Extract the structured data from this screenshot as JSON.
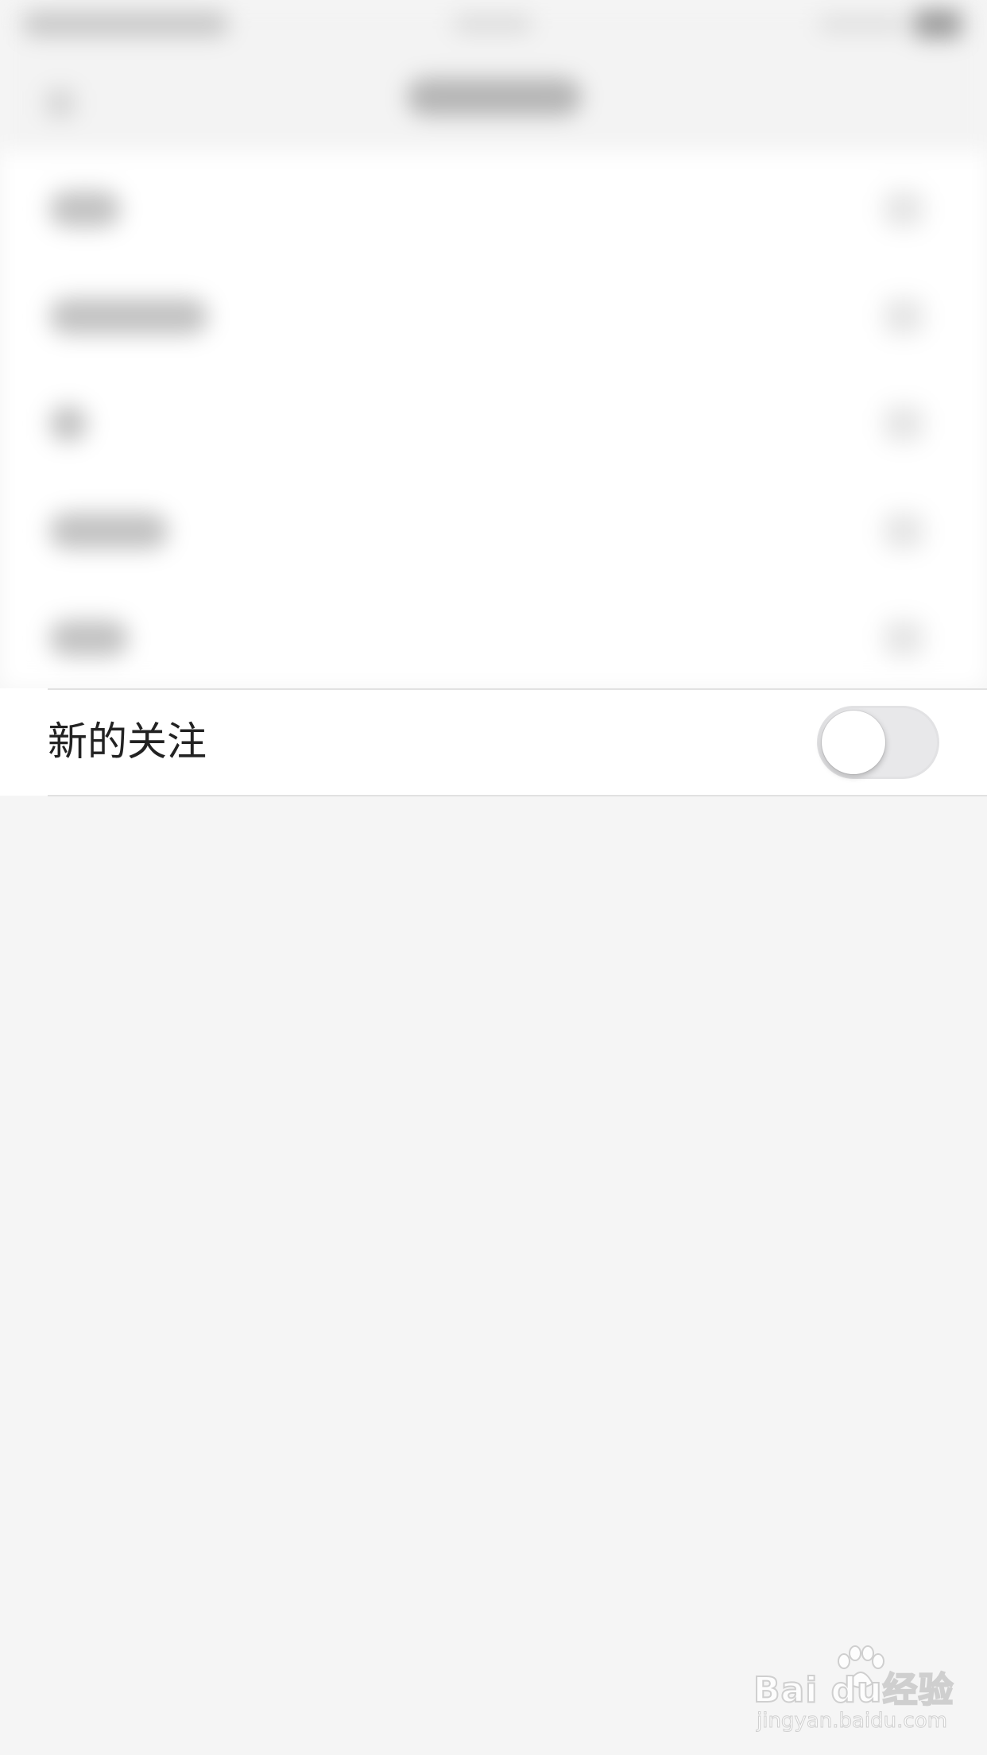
{
  "settings_row": {
    "label": "新的关注",
    "toggle_on": false
  },
  "watermark": {
    "brand": "Bai du经验",
    "url": "jingyan.baidu.com"
  },
  "colors": {
    "page_background": "#f5f5f5",
    "row_background": "#ffffff",
    "divider": "#e1e1e1",
    "toggle_off_track": "#e8e8ea",
    "label_text": "#222222"
  },
  "icons": {
    "toggle": "switch-off",
    "watermark_logo": "baidu-paw-icon"
  }
}
